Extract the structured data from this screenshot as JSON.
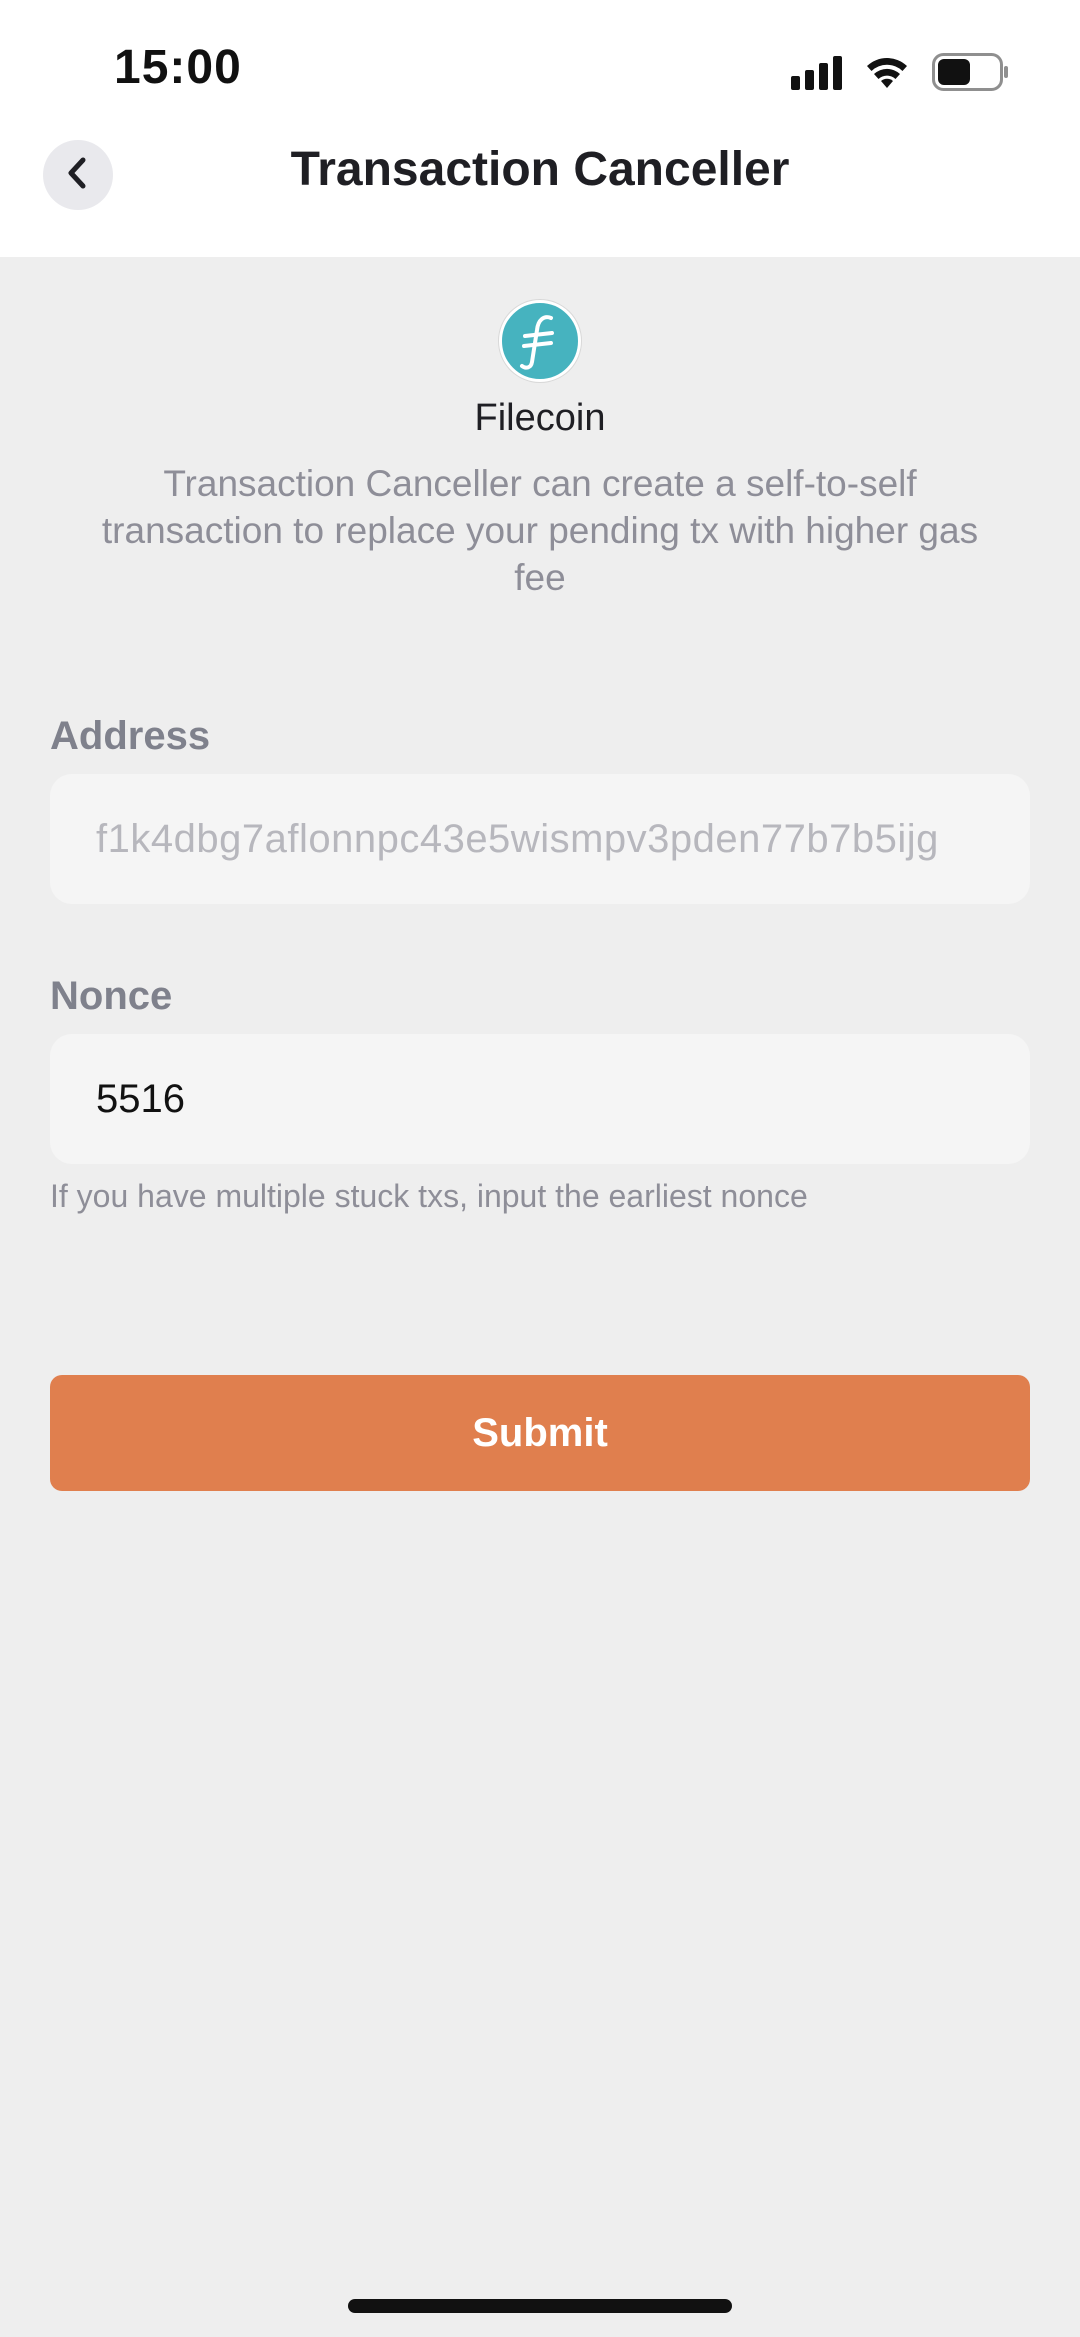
{
  "status_bar": {
    "time": "15:00",
    "icons": [
      "signal-icon",
      "wifi-icon",
      "battery-icon"
    ]
  },
  "header": {
    "title": "Transaction Canceller",
    "back_icon": "chevron-left-icon"
  },
  "coin": {
    "name": "Filecoin",
    "logo_icon": "filecoin-logo-icon",
    "logo_color": "#46b3bf"
  },
  "description": "Transaction Canceller can create a self-to-self transaction to replace your pending tx with higher gas fee",
  "form": {
    "address_label": "Address",
    "address_value": "f1k4dbg7aflonnpc43e5wismpv3pden77b7b5ijg",
    "nonce_label": "Nonce",
    "nonce_value": "5516",
    "nonce_hint": "If you have multiple stuck txs, input the earliest nonce"
  },
  "submit": {
    "label": "Submit",
    "color": "#e07f4e"
  }
}
